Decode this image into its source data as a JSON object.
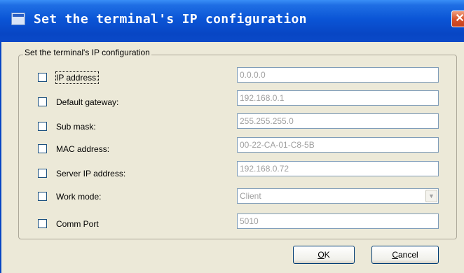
{
  "window": {
    "title": "Set the terminal's IP configuration",
    "close_glyph": "✕"
  },
  "group": {
    "caption": "Set the terminal's IP configuration"
  },
  "rows": [
    {
      "label": "IP address:",
      "checked": false,
      "value": "0.0.0.0",
      "type": "text",
      "enabled": false
    },
    {
      "label": "Default gateway:",
      "checked": false,
      "value": "192.168.0.1",
      "type": "text",
      "enabled": false
    },
    {
      "label": "Sub mask:",
      "checked": false,
      "value": "255.255.255.0",
      "type": "text",
      "enabled": false
    },
    {
      "label": "MAC address:",
      "checked": false,
      "value": "00-22-CA-01-C8-5B",
      "type": "text",
      "enabled": false
    },
    {
      "label": "Server IP address:",
      "checked": false,
      "value": "192.168.0.72",
      "type": "text",
      "enabled": false
    },
    {
      "label": "Work mode:",
      "checked": false,
      "value": "Client",
      "type": "select",
      "enabled": false
    },
    {
      "label": "Comm Port",
      "checked": false,
      "value": "5010",
      "type": "text",
      "enabled": false
    }
  ],
  "buttons": {
    "ok": {
      "mnemonic": "O",
      "rest": "K"
    },
    "cancel": {
      "mnemonic": "C",
      "rest": "ancel"
    }
  },
  "colors": {
    "titlebar": "#0846c4",
    "face": "#ece9d8",
    "disabled_text": "#a0a0a0"
  }
}
